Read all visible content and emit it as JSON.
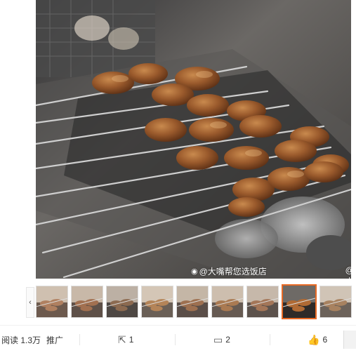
{
  "photo": {
    "alt": "",
    "watermark_left": "@大嘴帮您选饭店",
    "watermark_right": "@小海豹豹",
    "watermark_icon": "weibo-icon"
  },
  "gallery": {
    "prev_label": "‹",
    "thumbnail_count": 9,
    "active_index": 7,
    "accent_color": "#e86a25"
  },
  "actions": {
    "read_label": "阅读 1.3万",
    "promote_label": "推广",
    "share_count": "1",
    "comment_count": "2",
    "like_count": "6",
    "share_icon": "share-icon",
    "comment_icon": "comment-icon",
    "like_icon": "thumbs-up-icon"
  }
}
